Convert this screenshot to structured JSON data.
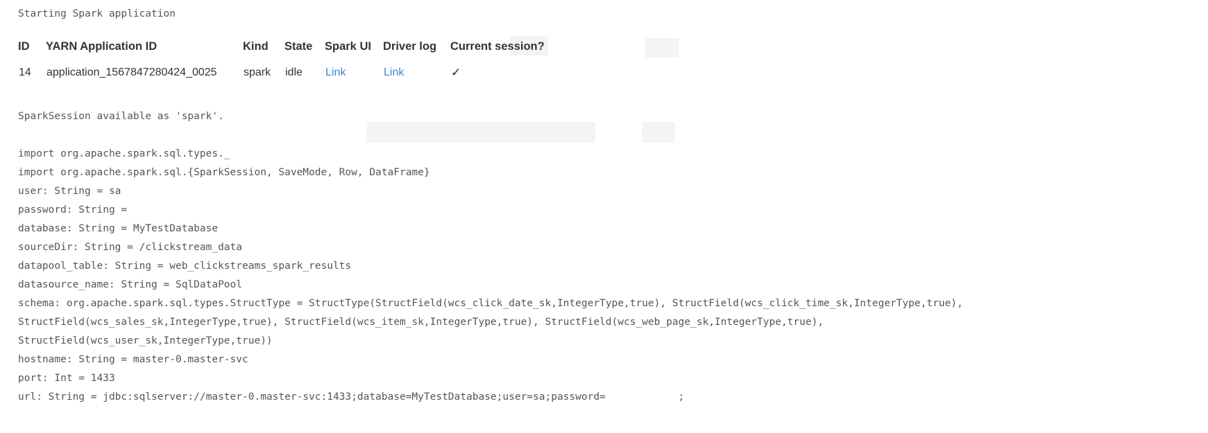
{
  "header_message": "Starting Spark application",
  "table": {
    "columns": [
      "ID",
      "YARN Application ID",
      "Kind",
      "State",
      "Spark UI",
      "Driver log",
      "Current session?"
    ],
    "rows": [
      {
        "id": "14",
        "yarn_application_id": "application_1567847280424_0025",
        "kind": "spark",
        "state": "idle",
        "spark_ui": "Link",
        "driver_log": "Link",
        "current_session": "✓"
      }
    ]
  },
  "colors": {
    "link": "#3b87c8",
    "text": "#333333",
    "console_text": "#555555",
    "background": "#ffffff",
    "ghost": "#f4f4f4"
  },
  "console": {
    "lines": [
      "SparkSession available as 'spark'.",
      "",
      "import org.apache.spark.sql.types._",
      "import org.apache.spark.sql.{SparkSession, SaveMode, Row, DataFrame}",
      "user: String = sa",
      "password: String = ",
      "database: String = MyTestDatabase",
      "sourceDir: String = /clickstream_data",
      "datapool_table: String = web_clickstreams_spark_results",
      "datasource_name: String = SqlDataPool",
      "schema: org.apache.spark.sql.types.StructType = StructType(StructField(wcs_click_date_sk,IntegerType,true), StructField(wcs_click_time_sk,IntegerType,true),",
      "StructField(wcs_sales_sk,IntegerType,true), StructField(wcs_item_sk,IntegerType,true), StructField(wcs_web_page_sk,IntegerType,true),",
      "StructField(wcs_user_sk,IntegerType,true))",
      "hostname: String = master-0.master-svc",
      "port: Int = 1433",
      "url: String = jdbc:sqlserver://master-0.master-svc:1433;database=MyTestDatabase;user=sa;password=            ;"
    ]
  }
}
